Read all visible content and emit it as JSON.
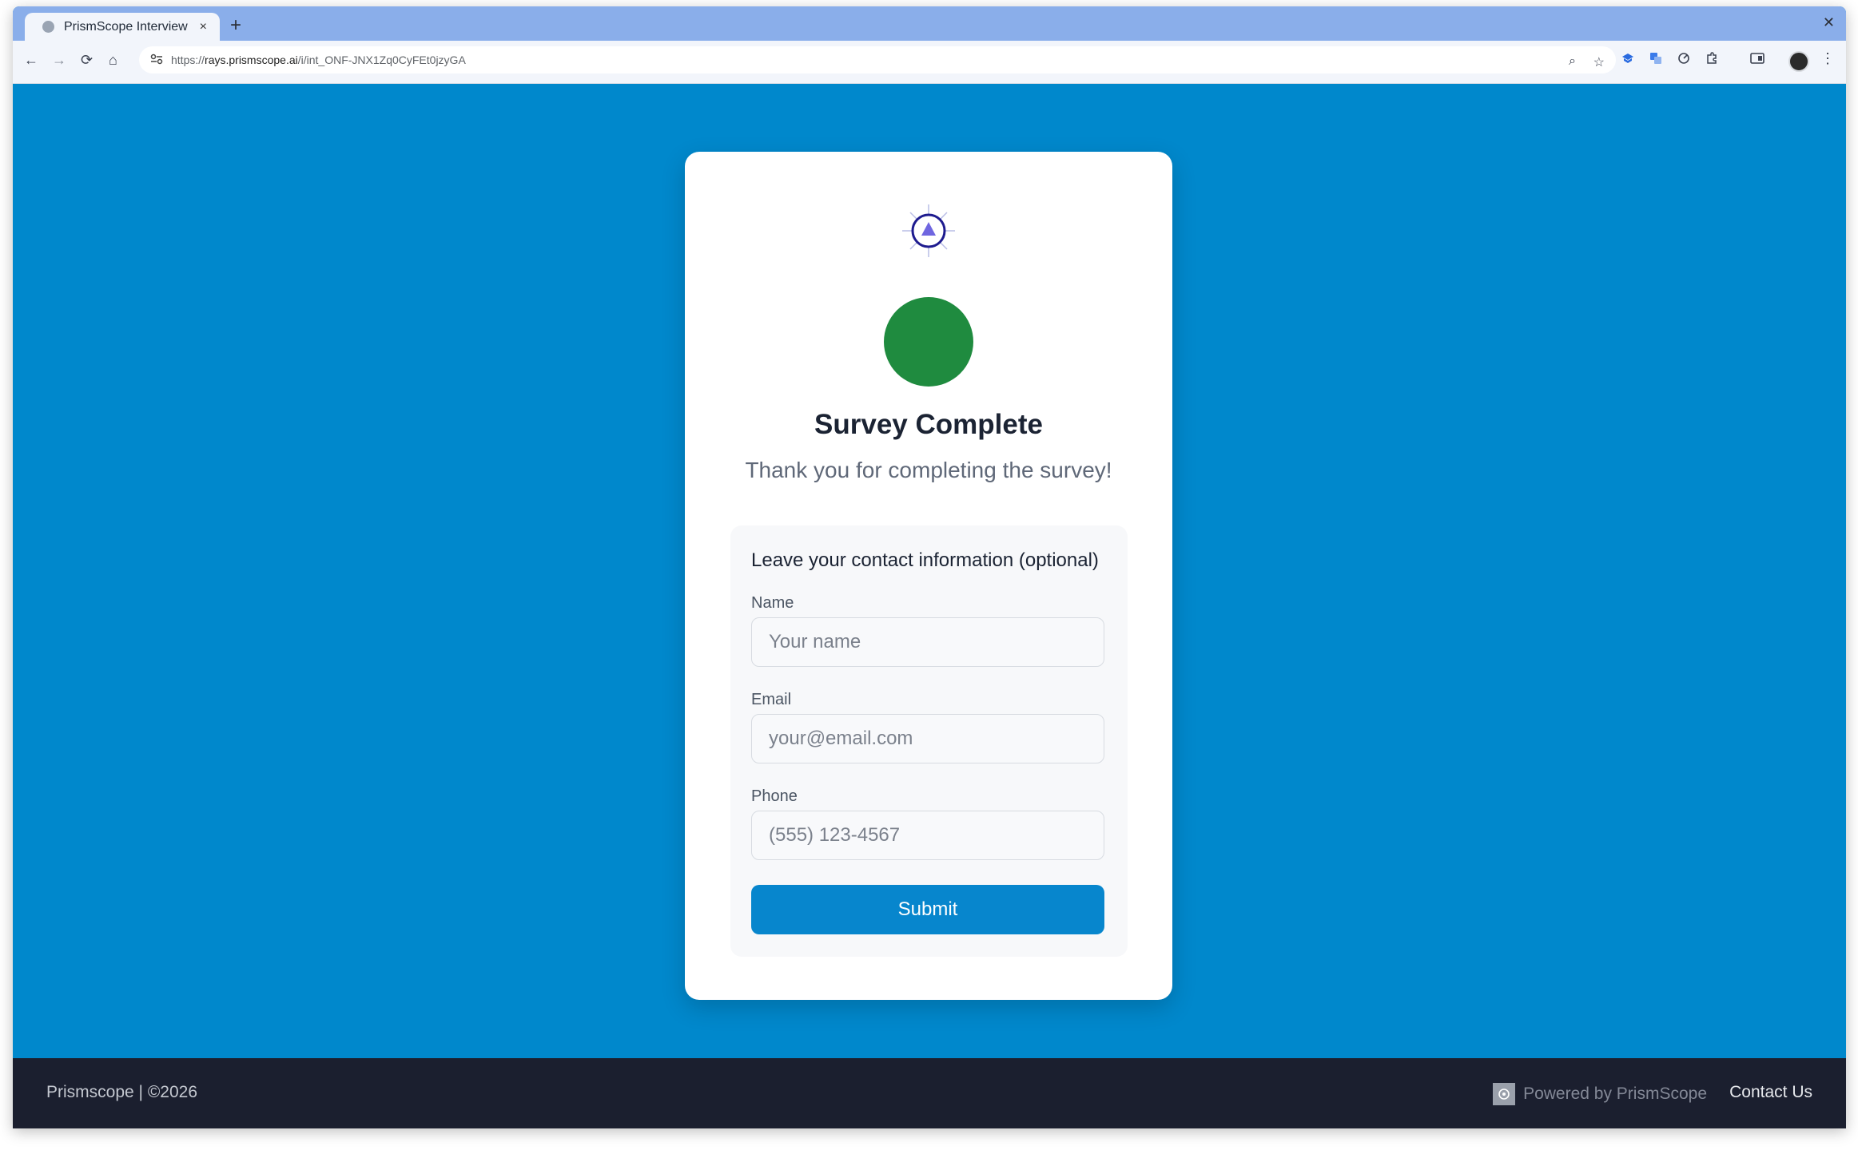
{
  "browser": {
    "tab_title": "PrismScope Interview",
    "tab_close": "×",
    "new_tab": "+",
    "window_close": "✕",
    "url_scheme": "https://",
    "url_host": "rays.prismscope.ai",
    "url_path": "/i/int_ONF-JNX1Zq0CyFEt0jzyGA",
    "icons": {
      "back": "←",
      "forward": "→",
      "reload": "⟳",
      "home": "⌂",
      "zoom": "⌕",
      "star": "☆",
      "menu": "⋮"
    }
  },
  "card": {
    "title": "Survey Complete",
    "subtitle": "Thank you for completing the survey!",
    "success_color": "#1f8b3f"
  },
  "contact_form": {
    "heading": "Leave your contact information (optional)",
    "name_label": "Name",
    "name_placeholder": "Your name",
    "email_label": "Email",
    "email_placeholder": "your@email.com",
    "phone_label": "Phone",
    "phone_placeholder": "(555) 123-4567",
    "submit_label": "Submit"
  },
  "footer": {
    "left_text": "Prismscope | ©2026",
    "powered_by": "Powered by PrismScope",
    "contact_link": "Contact Us"
  },
  "colors": {
    "page_background": "#0088cc",
    "submit_button": "#0786cd",
    "footer_background": "#1b1f2f"
  }
}
